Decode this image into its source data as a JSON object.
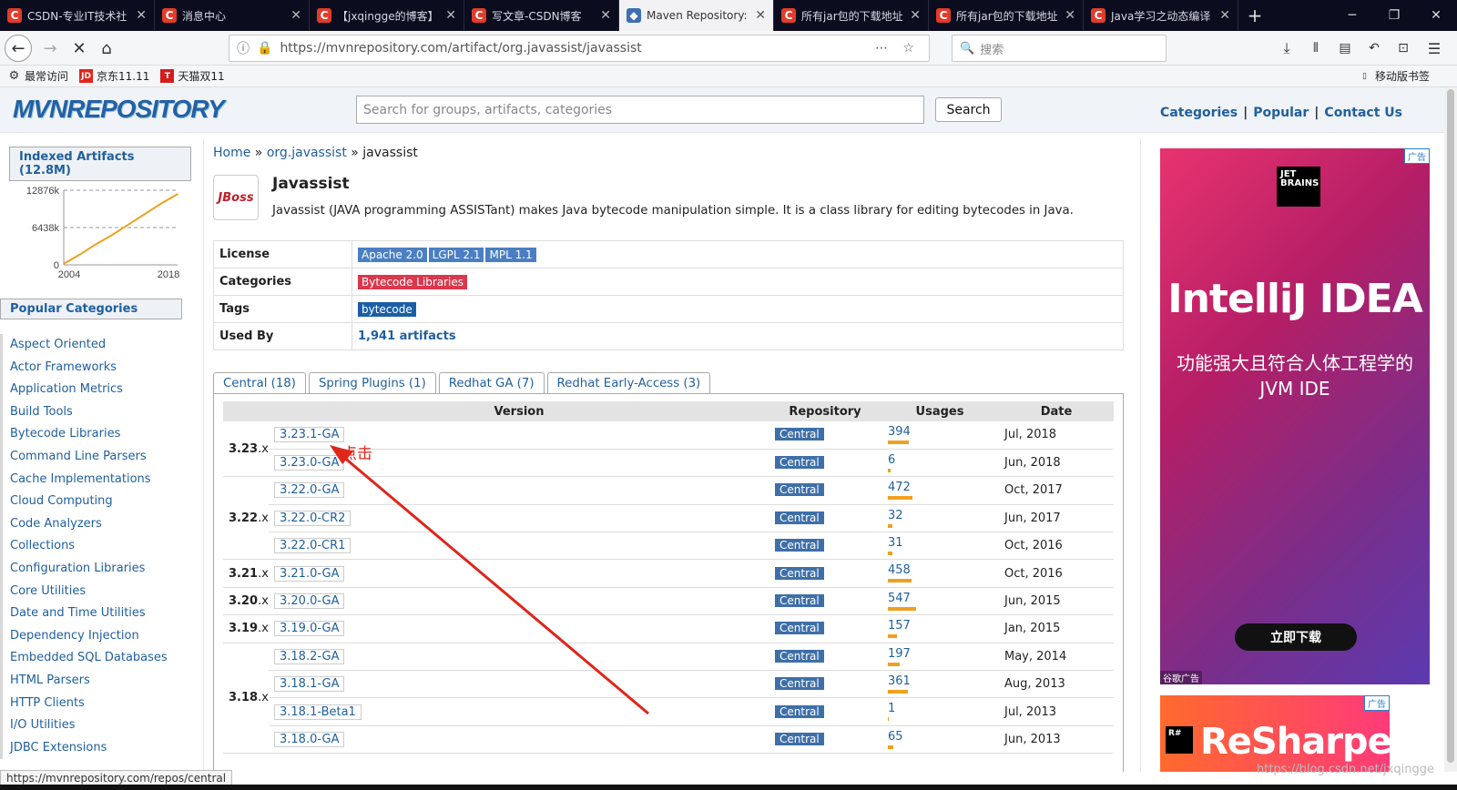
{
  "browser": {
    "tabs": [
      {
        "label": "CSDN-专业IT技术社",
        "icon": "csdn-icon",
        "active": false
      },
      {
        "label": "消息中心",
        "icon": "csdn-icon",
        "active": false
      },
      {
        "label": "【jxqingge的博客】",
        "icon": "csdn-icon",
        "active": false
      },
      {
        "label": "写文章-CSDN博客",
        "icon": "csdn-icon",
        "active": false
      },
      {
        "label": "Maven Repository:",
        "icon": "maven-icon",
        "active": true
      },
      {
        "label": "所有jar包的下载地址",
        "icon": "csdn-icon",
        "active": false
      },
      {
        "label": "所有jar包的下载地址",
        "icon": "csdn-icon",
        "active": false
      },
      {
        "label": "Java学习之动态编译",
        "icon": "csdn-icon",
        "active": false
      }
    ],
    "url_prefix": "https://mvnrepository.com",
    "url_path": "/artifact/org.javassist/javassist",
    "search_placeholder": "搜索",
    "bookmarks": [
      "最常访问",
      "京东11.11",
      "天猫双11"
    ],
    "mobile_bookmarks": "移动版书签",
    "status_url": "https://mvnrepository.com/repos/central"
  },
  "site": {
    "logo": "MVNREPOSITORY",
    "search_placeholder": "Search for groups, artifacts, categories",
    "search_button": "Search",
    "links": [
      "Categories",
      "Popular",
      "Contact Us"
    ]
  },
  "sidebar": {
    "indexed_title": "Indexed Artifacts (12.8M)",
    "popular_title": "Popular Categories",
    "categories": [
      "Aspect Oriented",
      "Actor Frameworks",
      "Application Metrics",
      "Build Tools",
      "Bytecode Libraries",
      "Command Line Parsers",
      "Cache Implementations",
      "Cloud Computing",
      "Code Analyzers",
      "Collections",
      "Configuration Libraries",
      "Core Utilities",
      "Date and Time Utilities",
      "Dependency Injection",
      "Embedded SQL Databases",
      "HTML Parsers",
      "HTTP Clients",
      "I/O Utilities",
      "JDBC Extensions"
    ]
  },
  "chart_data": {
    "type": "line",
    "x": [
      2004,
      2006,
      2008,
      2010,
      2012,
      2014,
      2016,
      2018
    ],
    "values": [
      200,
      1800,
      3600,
      5200,
      7000,
      8800,
      10600,
      12200
    ],
    "yticks": [
      "12876k",
      "6438k",
      "0"
    ],
    "xticks": [
      "2004",
      "2018"
    ],
    "ylim": [
      0,
      12876
    ],
    "color": "#f0a020"
  },
  "breadcrumb": {
    "home": "Home",
    "group": "org.javassist",
    "artifact": "javassist"
  },
  "artifact": {
    "logo_text": "JBoss",
    "title": "Javassist",
    "description": "Javassist (JAVA programming ASSISTant) makes Java bytecode manipulation simple. It is a class library for editing bytecodes in Java.",
    "license_label": "License",
    "licenses": [
      "Apache 2.0",
      "LGPL 2.1",
      "MPL 1.1"
    ],
    "categories_label": "Categories",
    "category": "Bytecode Libraries",
    "tags_label": "Tags",
    "tag": "bytecode",
    "usedby_label": "Used By",
    "usedby": "1,941 artifacts"
  },
  "repo_tabs": [
    "Central (18)",
    "Spring Plugins (1)",
    "Redhat GA (7)",
    "Redhat Early-Access (3)"
  ],
  "versions": {
    "headers": [
      "Version",
      "Repository",
      "Usages",
      "Date"
    ],
    "rows": [
      {
        "major": "3.23",
        "version": "3.23.1-GA",
        "repo": "Central",
        "usages": "394",
        "date": "Jul, 2018",
        "bar": 0.72
      },
      {
        "major": "",
        "version": "3.23.0-GA",
        "repo": "Central",
        "usages": "6",
        "date": "Jun, 2018",
        "bar": 0.08
      },
      {
        "major": "3.22",
        "version": "3.22.0-GA",
        "repo": "Central",
        "usages": "472",
        "date": "Oct, 2017",
        "bar": 0.85
      },
      {
        "major": "",
        "version": "3.22.0-CR2",
        "repo": "Central",
        "usages": "32",
        "date": "Jun, 2017",
        "bar": 0.15
      },
      {
        "major": "",
        "version": "3.22.0-CR1",
        "repo": "Central",
        "usages": "31",
        "date": "Oct, 2016",
        "bar": 0.15
      },
      {
        "major": "3.21",
        "version": "3.21.0-GA",
        "repo": "Central",
        "usages": "458",
        "date": "Oct, 2016",
        "bar": 0.82
      },
      {
        "major": "3.20",
        "version": "3.20.0-GA",
        "repo": "Central",
        "usages": "547",
        "date": "Jun, 2015",
        "bar": 0.97
      },
      {
        "major": "3.19",
        "version": "3.19.0-GA",
        "repo": "Central",
        "usages": "157",
        "date": "Jan, 2015",
        "bar": 0.32
      },
      {
        "major": "3.18",
        "version": "3.18.2-GA",
        "repo": "Central",
        "usages": "197",
        "date": "May, 2014",
        "bar": 0.4
      },
      {
        "major": "",
        "version": "3.18.1-GA",
        "repo": "Central",
        "usages": "361",
        "date": "Aug, 2013",
        "bar": 0.68
      },
      {
        "major": "",
        "version": "3.18.1-Beta1",
        "repo": "Central",
        "usages": "1",
        "date": "Jul, 2013",
        "bar": 0.04
      },
      {
        "major": "",
        "version": "3.18.0-GA",
        "repo": "Central",
        "usages": "65",
        "date": "Jun, 2013",
        "bar": 0.18
      }
    ]
  },
  "annotation": "点击",
  "ads": {
    "ad1_brand": "JET BRAINS",
    "ad1_title": "IntelliJ IDEA",
    "ad1_sub": "功能强大且符合人体工程学的 JVM IDE",
    "ad1_button": "立即下载",
    "ad1_tag": "广告",
    "ad1_footer": "谷歌广告",
    "ad2_brand": "R#",
    "ad2_title": "ReSharper",
    "ad2_tag": "广告"
  },
  "watermark": "https://blog.csdn.net/jxqingge"
}
